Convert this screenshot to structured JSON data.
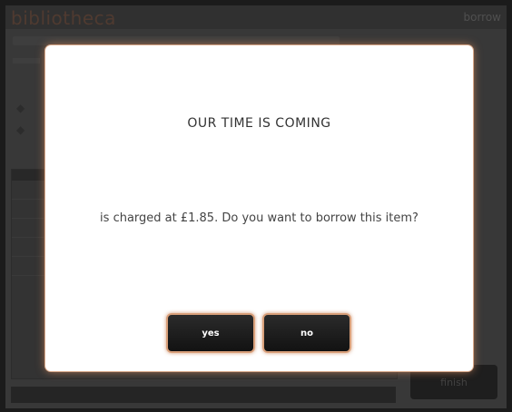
{
  "app": {
    "brand": "bibliotheca",
    "nav_borrow": "borrow"
  },
  "bottom": {
    "finish_label": "finish"
  },
  "dialog": {
    "title": "OUR TIME IS COMING",
    "message": "is charged at £1.85. Do you want to borrow this item?",
    "yes_label": "yes",
    "no_label": "no"
  }
}
